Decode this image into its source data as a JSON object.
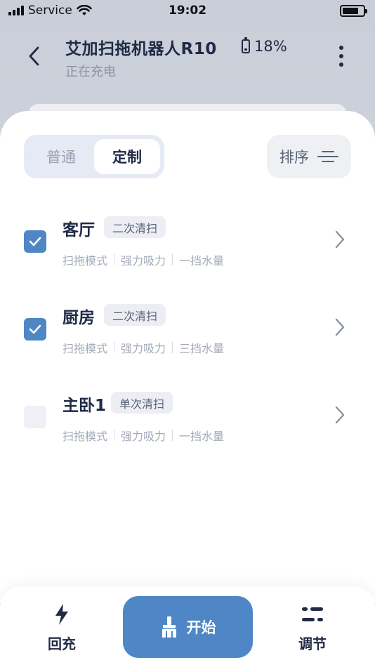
{
  "status_bar": {
    "carrier": "Service",
    "time": "19:02",
    "battery_level_percent": 80
  },
  "header": {
    "title": "艾加扫拖机器人R10",
    "subtitle": "正在充电",
    "battery_text": "18%",
    "battery_level_percent": 18
  },
  "tabs": {
    "items": [
      {
        "label": "普通",
        "active": false
      },
      {
        "label": "定制",
        "active": true
      }
    ],
    "sort_label": "排序"
  },
  "rooms": [
    {
      "name": "客厅",
      "badge": "二次清扫",
      "checked": true,
      "mode": "扫拖模式",
      "suction": "强力吸力",
      "water": "一挡水量"
    },
    {
      "name": "厨房",
      "badge": "二次清扫",
      "checked": true,
      "mode": "扫拖模式",
      "suction": "强力吸力",
      "water": "三挡水量"
    },
    {
      "name": "主卧1",
      "badge": "单次清扫",
      "checked": false,
      "mode": "扫拖模式",
      "suction": "强力吸力",
      "water": "一挡水量"
    }
  ],
  "bottom_bar": {
    "recharge_label": "回充",
    "start_label": "开始",
    "adjust_label": "调节"
  },
  "colors": {
    "accent": "#4f86c6",
    "title": "#1f2a44",
    "muted": "#a3aab8"
  }
}
